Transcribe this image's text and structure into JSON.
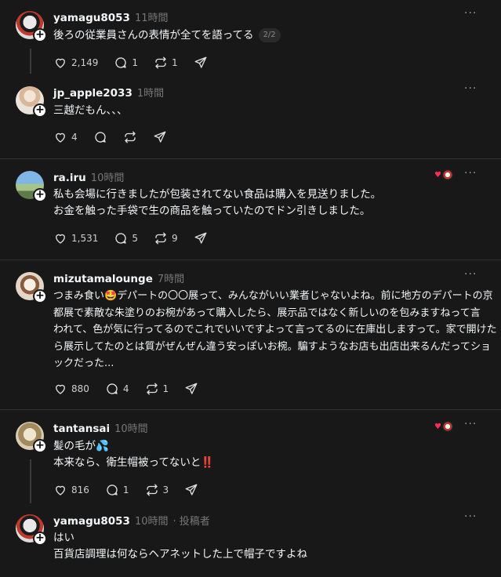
{
  "posts": [
    {
      "username": "yamagu8053",
      "time": "11時間",
      "role": "",
      "lines": [
        "後ろの従業員さんの表情が全てを語ってる"
      ],
      "pager": "2/2",
      "likes": "2,149",
      "replies": "1",
      "reposts": "1",
      "avatar_color": "#c9c9c9"
    },
    {
      "username": "jp_apple2033",
      "time": "1時間",
      "role": "",
      "lines": [
        "三越だもん、、、"
      ],
      "likes": "4",
      "replies": "",
      "reposts": "",
      "avatar_color": "#e8d3c0"
    },
    {
      "username": "ra.iru",
      "time": "10時間",
      "role": "",
      "lines": [
        "私も会場に行きましたが包装されてない食品は購入を見送りました。",
        "お金を触った手袋で生の商品を触っていたのでドン引きしました。"
      ],
      "likes": "1,531",
      "replies": "5",
      "reposts": "9",
      "avatar_color": "#6aa7d8"
    },
    {
      "username": "mizutamalounge",
      "time": "7時間",
      "role": "",
      "lines": [
        "つまみ食い🤩デパートの〇〇展って、みんながいい業者じゃないよね。前に地方のデパートの京",
        "都展で素敵な朱塗りのお椀があって購入したら、展示品ではなく新しいのを包みますねって言",
        "われて、色が気に行ってるのでこれでいいですよって言ってるのに在庫出しますって。家で開けた",
        "ら展示してたのとは質がぜんぜん違う安っぽいお椀。騙すようなお店も出店出来るんだってショ",
        "ックだった..."
      ],
      "likes": "880",
      "replies": "4",
      "reposts": "1",
      "avatar_color": "#d8c4b0"
    },
    {
      "username": "tantansai",
      "time": "10時間",
      "role": "",
      "lines": [
        "髪の毛が💦",
        "本来なら、衛生帽被ってないと‼️"
      ],
      "likes": "816",
      "replies": "1",
      "reposts": "3",
      "avatar_color": "#b8a990"
    },
    {
      "username": "yamagu8053",
      "time": "10時間",
      "role": "· 投稿者",
      "lines": [
        "はい",
        "百貨店調理は何ならヘアネットした上で帽子ですよね"
      ],
      "avatar_color": "#c9c9c9"
    }
  ],
  "more_glyph": "···",
  "colors": {
    "background": "#181818",
    "divider": "#323232",
    "text": "#f3f5f7",
    "muted": "#777777"
  },
  "icons": [
    "heart-icon",
    "reply-icon",
    "repost-icon",
    "share-icon",
    "more-icon",
    "follow-plus-icon"
  ]
}
